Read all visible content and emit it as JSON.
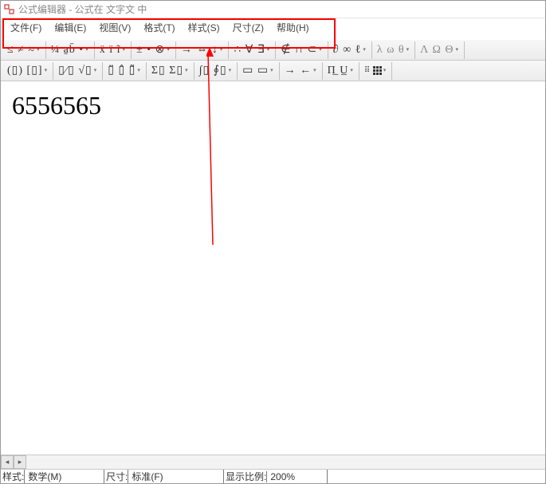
{
  "title": "公式编辑器 - 公式在 文字文 中",
  "menu": {
    "file": "文件(F)",
    "edit": "编辑(E)",
    "view": "视图(V)",
    "format": "格式(T)",
    "style": "样式(S)",
    "size": "尺寸(Z)",
    "help": "帮助(H)"
  },
  "toolbar1": {
    "g1": "≤ ≠ ≈",
    "g2": "¼ a̱b̄ •",
    "g3": "ẍ ï ĩ",
    "g4": "± • ⊗",
    "g5": "→ ⇔ ↓",
    "g6": "∴ ∀ ∃",
    "g7": "∉ ∩ ⊂",
    "g8": "∂ ∞ ℓ",
    "g9": "λ ω θ",
    "g10": "Λ Ω Θ"
  },
  "toolbar2": {
    "g1": "(▯) [▯]",
    "g2": "▯⁄▯ √▯",
    "g3": "▯̈  ▯̂  ▯̃",
    "g4": "Σ▯ Σ▯",
    "g5": "∫▯ ∮▯",
    "g6": "▭ ▭",
    "g7": "→ ←",
    "g8": "Π̲  U̲",
    "g9": "matrix"
  },
  "editor": {
    "formula": "6556565"
  },
  "status": {
    "style_label": "样式:",
    "style_value": "数学(M)",
    "size_label": "尺寸:",
    "size_value": "标准(F)",
    "zoom_label": "显示比例:",
    "zoom_value": "200%"
  }
}
